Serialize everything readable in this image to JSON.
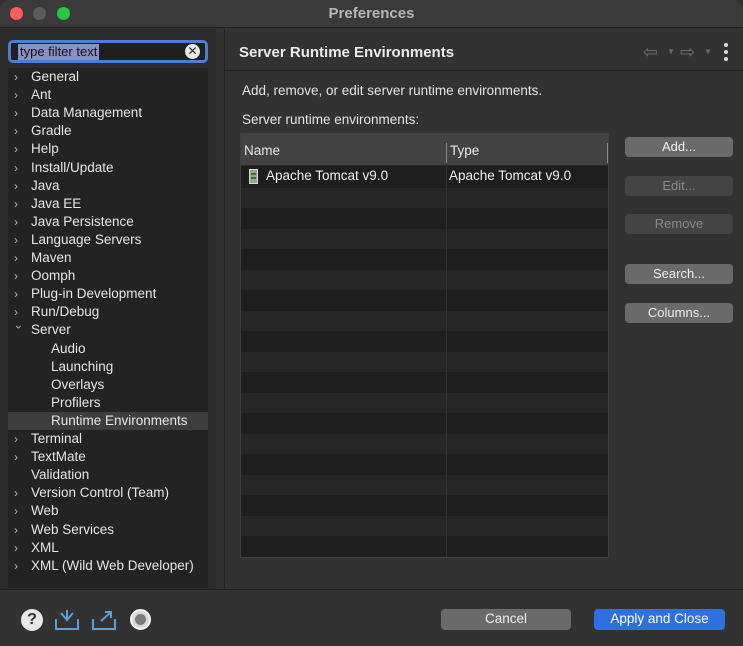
{
  "window": {
    "title": "Preferences"
  },
  "filter": {
    "value": "type filter text"
  },
  "tree": {
    "items": [
      {
        "label": "General",
        "expandable": true
      },
      {
        "label": "Ant",
        "expandable": true
      },
      {
        "label": "Data Management",
        "expandable": true
      },
      {
        "label": "Gradle",
        "expandable": true
      },
      {
        "label": "Help",
        "expandable": true
      },
      {
        "label": "Install/Update",
        "expandable": true
      },
      {
        "label": "Java",
        "expandable": true
      },
      {
        "label": "Java EE",
        "expandable": true
      },
      {
        "label": "Java Persistence",
        "expandable": true
      },
      {
        "label": "Language Servers",
        "expandable": true
      },
      {
        "label": "Maven",
        "expandable": true
      },
      {
        "label": "Oomph",
        "expandable": true
      },
      {
        "label": "Plug-in Development",
        "expandable": true
      },
      {
        "label": "Run/Debug",
        "expandable": true
      },
      {
        "label": "Server",
        "expandable": true,
        "expanded": true
      },
      {
        "label": "Audio",
        "child": true
      },
      {
        "label": "Launching",
        "child": true
      },
      {
        "label": "Overlays",
        "child": true
      },
      {
        "label": "Profilers",
        "child": true
      },
      {
        "label": "Runtime Environments",
        "child": true,
        "selected": true
      },
      {
        "label": "Terminal",
        "expandable": true
      },
      {
        "label": "TextMate",
        "expandable": true
      },
      {
        "label": "Validation",
        "expandable": false
      },
      {
        "label": "Version Control (Team)",
        "expandable": true
      },
      {
        "label": "Web",
        "expandable": true
      },
      {
        "label": "Web Services",
        "expandable": true
      },
      {
        "label": "XML",
        "expandable": true
      },
      {
        "label": "XML (Wild Web Developer)",
        "expandable": true
      }
    ]
  },
  "page": {
    "title": "Server Runtime Environments",
    "description": "Add, remove, or edit server runtime environments.",
    "list_label": "Server runtime environments:"
  },
  "table": {
    "columns": [
      "Name",
      "Type"
    ],
    "rows": [
      {
        "name": "Apache Tomcat v9.0",
        "type": "Apache Tomcat v9.0",
        "icon": "server-icon"
      }
    ]
  },
  "buttons": {
    "add": "Add...",
    "edit": "Edit...",
    "remove": "Remove",
    "search": "Search...",
    "columns": "Columns..."
  },
  "footer": {
    "cancel": "Cancel",
    "apply": "Apply and Close"
  },
  "colors": {
    "accent": "#2f6fe0",
    "focus_ring": "#4b7fd0"
  }
}
